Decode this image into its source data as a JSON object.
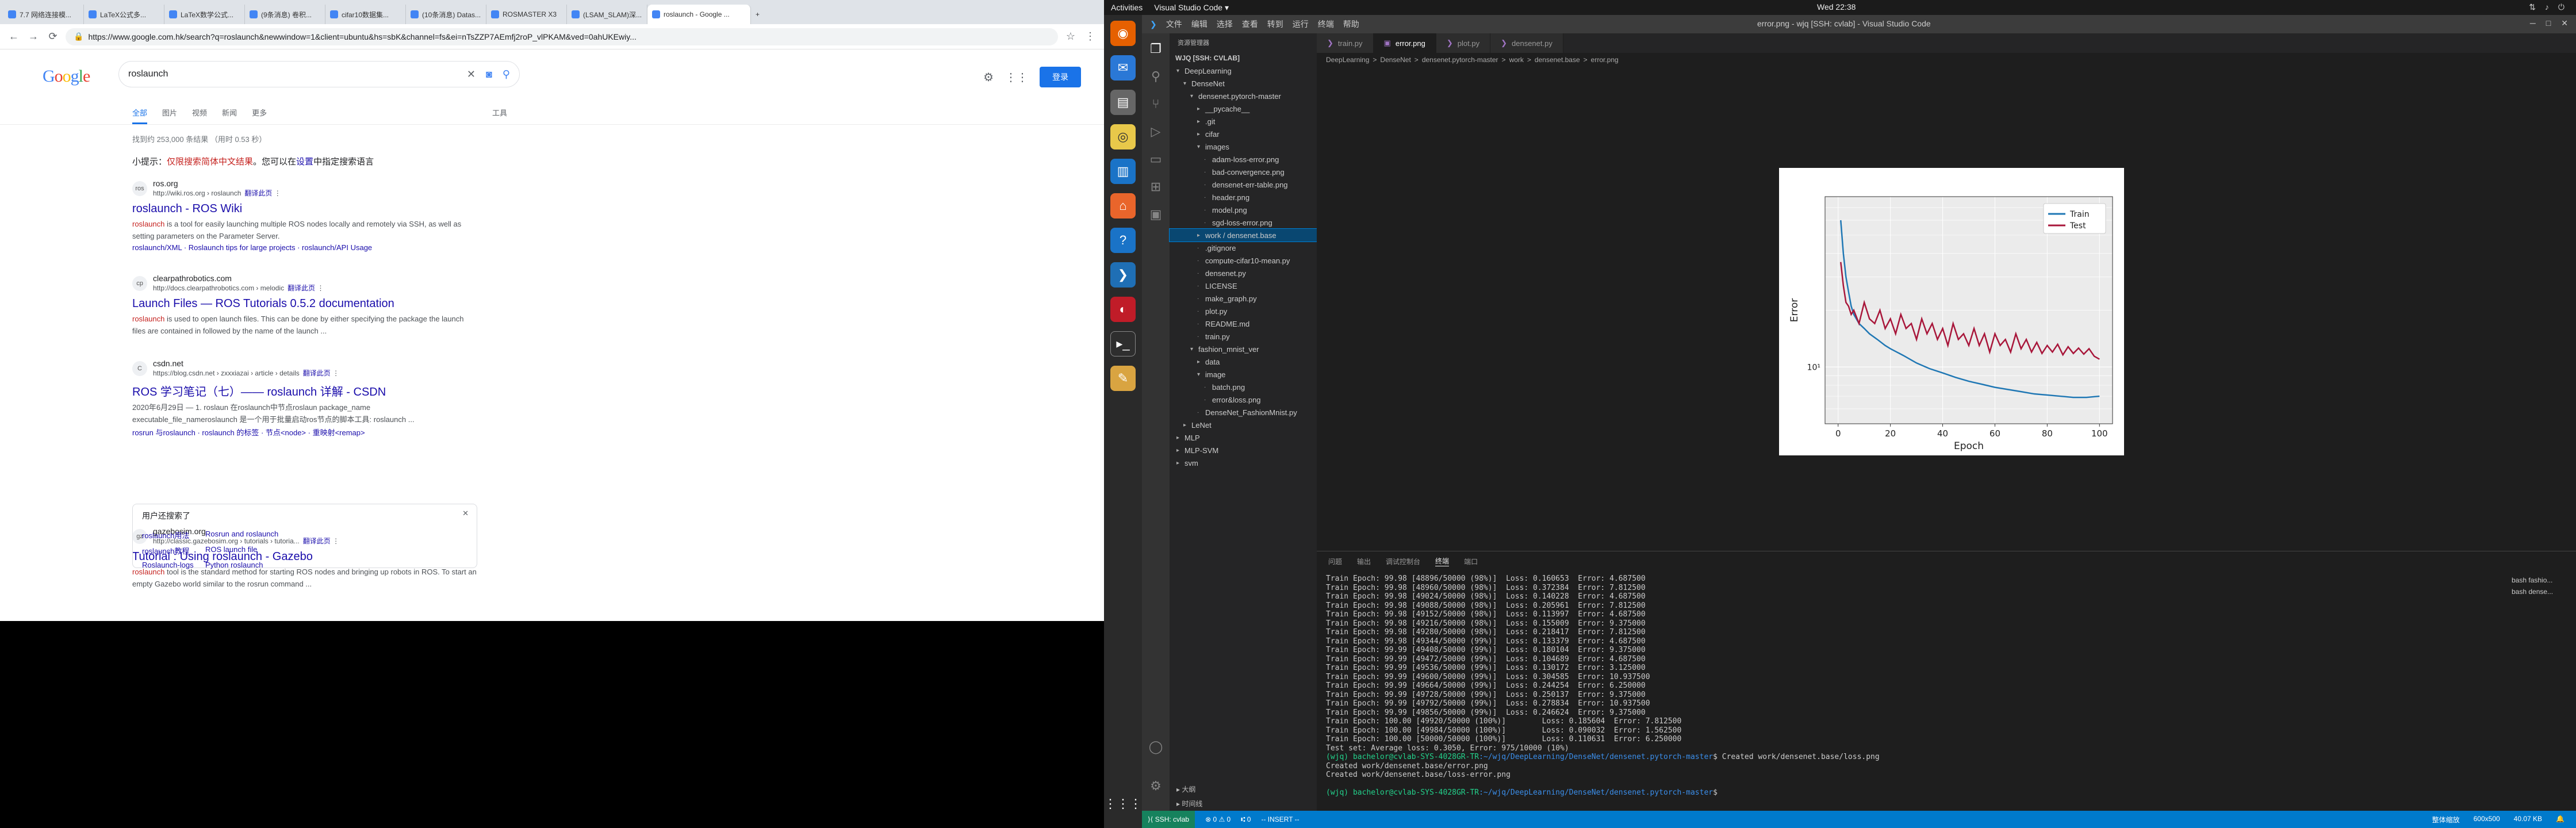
{
  "chrome": {
    "tabs": [
      "7.7 网络连接模...",
      "LaTeX公式多...",
      "LaTeX数学公式...",
      "(9条消息) 卷积...",
      "cifar10数据集...",
      "(10条消息) Datas...",
      "ROSMASTER X3",
      "(LSAM_SLAM)深...",
      "roslaunch - Google ..."
    ],
    "url": "https://www.google.com.hk/search?q=roslaunch&newwindow=1&client=ubuntu&hs=sbK&channel=fs&ei=nTsZZP7AEmfj2roP_vlPKAM&ved=0ahUKEwiy..."
  },
  "google": {
    "logo": "Google",
    "query": "roslaunch",
    "signin": "登录",
    "tabs": [
      "全部",
      "图片",
      "视频",
      "新闻",
      "更多"
    ],
    "tools": "工具",
    "stats": "找到约 253,000 条结果 （用时 0.53 秒）",
    "tip_prefix": "小提示：",
    "tip_red": "仅限搜索简体中文结果",
    "tip_mid": "。您可以在",
    "tip_link": "设置",
    "tip_suffix": "中指定搜索语言",
    "translate": "翻译此页",
    "results": [
      {
        "fav": "ros",
        "name": "ros.org",
        "url": "http://wiki.ros.org › roslaunch",
        "title": "roslaunch - ROS Wiki",
        "snip_em": "roslaunch",
        "snip": " is a tool for easily launching multiple ROS nodes locally and remotely via SSH, as well as setting parameters on the Parameter Server.",
        "links": "roslaunch/XML · Roslaunch tips for large projects · roslaunch/API Usage"
      },
      {
        "fav": "cp",
        "name": "clearpathrobotics.com",
        "url": "http://docs.clearpathrobotics.com › melodic",
        "title": "Launch Files — ROS Tutorials 0.5.2 documentation",
        "snip_em": "roslaunch",
        "snip": " is used to open launch files. This can be done by either specifying the package the launch files are contained in followed by the name of the launch ...",
        "links": ""
      },
      {
        "fav": "C",
        "name": "csdn.net",
        "url": "https://blog.csdn.net › zxxxiazai › article › details",
        "title": "ROS 学习笔记（七）—— roslaunch 详解 - CSDN",
        "snip_em": "",
        "snip": "2020年6月29日 — 1. roslaun 在roslaunch中节点roslaun package_name executable_file_nameroslaunch 是一个用于批量启动ros节点的脚本工具: roslaunch ...",
        "links": "rosrun 与roslaunch · roslaunch 的标签 · 节点<node> · 重映射<remap>"
      },
      {
        "fav": "gz",
        "name": "gazebosim.org",
        "url": "http://classic.gazebosim.org › tutorials › tutoria...",
        "title": "Tutorial : Using roslaunch - Gazebo",
        "snip_em": "roslaunch",
        "snip": " tool is the standard method for starting ROS nodes and bringing up robots in ROS. To start an empty Gazebo world similar to the rosrun command ...",
        "links": ""
      }
    ],
    "ask": {
      "title": "用户还搜索了",
      "items": [
        "roslaunch用法",
        "Rosrun and roslaunch",
        "roslaunch教程",
        "ROS launch file",
        "Roslaunch-logs",
        "Python roslaunch"
      ]
    }
  },
  "desktop": {
    "activities": "Activities",
    "app": "Visual Studio Code ▾",
    "clock": "Wed 22:38"
  },
  "vscode": {
    "menu": [
      "文件",
      "编辑",
      "选择",
      "查看",
      "转到",
      "运行",
      "终端",
      "帮助"
    ],
    "title": "error.png - wjq [SSH: cvlab] - Visual Studio Code",
    "explorer": "资源管理器",
    "root": "WJQ [SSH: CVLAB]",
    "tree": [
      {
        "d": 1,
        "a": "v",
        "t": "DeepLearning"
      },
      {
        "d": 2,
        "a": "v",
        "t": "DenseNet"
      },
      {
        "d": 3,
        "a": "v",
        "t": "densenet.pytorch-master"
      },
      {
        "d": 4,
        "a": ">",
        "t": "__pycache__"
      },
      {
        "d": 4,
        "a": ">",
        "t": ".git"
      },
      {
        "d": 4,
        "a": ">",
        "t": "cifar"
      },
      {
        "d": 4,
        "a": "v",
        "t": "images"
      },
      {
        "d": 5,
        "a": "",
        "t": "adam-loss-error.png"
      },
      {
        "d": 5,
        "a": "",
        "t": "bad-convergence.png"
      },
      {
        "d": 5,
        "a": "",
        "t": "densenet-err-table.png"
      },
      {
        "d": 5,
        "a": "",
        "t": "header.png"
      },
      {
        "d": 5,
        "a": "",
        "t": "model.png"
      },
      {
        "d": 5,
        "a": "",
        "t": "sgd-loss-error.png"
      },
      {
        "d": 4,
        "a": ">",
        "t": "work / densenet.base",
        "sel": true
      },
      {
        "d": 4,
        "a": "",
        "t": ".gitignore"
      },
      {
        "d": 4,
        "a": "",
        "t": "compute-cifar10-mean.py"
      },
      {
        "d": 4,
        "a": "",
        "t": "densenet.py"
      },
      {
        "d": 4,
        "a": "",
        "t": "LICENSE"
      },
      {
        "d": 4,
        "a": "",
        "t": "make_graph.py"
      },
      {
        "d": 4,
        "a": "",
        "t": "plot.py"
      },
      {
        "d": 4,
        "a": "",
        "t": "README.md"
      },
      {
        "d": 4,
        "a": "",
        "t": "train.py"
      },
      {
        "d": 3,
        "a": "v",
        "t": "fashion_mnist_ver"
      },
      {
        "d": 4,
        "a": ">",
        "t": "data"
      },
      {
        "d": 4,
        "a": "v",
        "t": "image"
      },
      {
        "d": 5,
        "a": "",
        "t": "batch.png"
      },
      {
        "d": 5,
        "a": "",
        "t": "error&loss.png"
      },
      {
        "d": 4,
        "a": "",
        "t": "DenseNet_FashionMnist.py"
      },
      {
        "d": 2,
        "a": ">",
        "t": "LeNet"
      },
      {
        "d": 1,
        "a": ">",
        "t": "MLP"
      },
      {
        "d": 1,
        "a": ">",
        "t": "MLP-SVM"
      },
      {
        "d": 1,
        "a": ">",
        "t": "svm"
      }
    ],
    "side_bottom": [
      "大纲",
      "时间线"
    ],
    "tabs": [
      {
        "t": "train.py",
        "on": false
      },
      {
        "t": "error.png",
        "on": true
      },
      {
        "t": "plot.py",
        "on": false
      },
      {
        "t": "densenet.py",
        "on": false
      }
    ],
    "crumbs": [
      "DeepLearning",
      ">",
      "DenseNet",
      ">",
      "densenet.pytorch-master",
      ">",
      "work",
      ">",
      "densenet.base",
      ">",
      "error.png"
    ],
    "panel_tabs": [
      "问题",
      "输出",
      "调试控制台",
      "终端",
      "端口"
    ],
    "terminal": [
      "Train Epoch: 99.98 [48896/50000 (98%)]  Loss: 0.160653  Error: 4.687500",
      "Train Epoch: 99.98 [48960/50000 (98%)]  Loss: 0.372384  Error: 7.812500",
      "Train Epoch: 99.98 [49024/50000 (98%)]  Loss: 0.140228  Error: 4.687500",
      "Train Epoch: 99.98 [49088/50000 (98%)]  Loss: 0.205961  Error: 7.812500",
      "Train Epoch: 99.98 [49152/50000 (98%)]  Loss: 0.113997  Error: 4.687500",
      "Train Epoch: 99.98 [49216/50000 (98%)]  Loss: 0.155009  Error: 9.375000",
      "Train Epoch: 99.98 [49280/50000 (98%)]  Loss: 0.218417  Error: 7.812500",
      "Train Epoch: 99.98 [49344/50000 (99%)]  Loss: 0.133379  Error: 4.687500",
      "Train Epoch: 99.99 [49408/50000 (99%)]  Loss: 0.180104  Error: 9.375000",
      "Train Epoch: 99.99 [49472/50000 (99%)]  Loss: 0.104689  Error: 4.687500",
      "Train Epoch: 99.99 [49536/50000 (99%)]  Loss: 0.130172  Error: 3.125000",
      "Train Epoch: 99.99 [49600/50000 (99%)]  Loss: 0.304585  Error: 10.937500",
      "Train Epoch: 99.99 [49664/50000 (99%)]  Loss: 0.244254  Error: 6.250000",
      "Train Epoch: 99.99 [49728/50000 (99%)]  Loss: 0.250137  Error: 9.375000",
      "Train Epoch: 99.99 [49792/50000 (99%)]  Loss: 0.278834  Error: 10.937500",
      "Train Epoch: 99.99 [49856/50000 (99%)]  Loss: 0.246624  Error: 9.375000",
      "Train Epoch: 100.00 [49920/50000 (100%)]        Loss: 0.185604  Error: 7.812500",
      "Train Epoch: 100.00 [49984/50000 (100%)]        Loss: 0.090032  Error: 1.562500",
      "Train Epoch: 100.00 [50000/50000 (100%)]        Loss: 0.110631  Error: 6.250000",
      "",
      "Test set: Average loss: 0.3050, Error: 975/10000 (10%)",
      ""
    ],
    "prompt_user": "(wjq) bachelor@cvlab-SYS-4028GR-TR",
    "prompt_path": ":~/wjq/DeepLearning/DenseNet/densenet.pytorch-master",
    "cmd1": "$ Created work/densenet.base/loss.png",
    "out1": "Created work/densenet.base/error.png",
    "out2": "Created work/densenet.base/loss-error.png",
    "cmd2": "$ ",
    "term_list": [
      "bash fashio...",
      "bash dense..."
    ],
    "status": {
      "remote": "⟩⟨ SSH: cvlab",
      "errors": "⊗ 0 ⚠ 0",
      "ports": "⑆ 0",
      "mode": "-- INSERT --",
      "dims": "600x500",
      "size": "40.07 KB",
      "zoom": "整体缩放"
    }
  },
  "chart_data": {
    "type": "line",
    "xlabel": "Epoch",
    "ylabel": "Error",
    "yscale": "log",
    "xlim": [
      -5,
      105
    ],
    "xticks": [
      0,
      20,
      40,
      60,
      80,
      100
    ],
    "ytick_label": "10¹",
    "ytick_value": 10,
    "grid": true,
    "legend": "top-right",
    "colors": {
      "Train": "#1f77b4",
      "Test": "#a8163a"
    },
    "series": [
      {
        "name": "Train",
        "x": [
          1,
          2,
          3,
          4,
          5,
          6,
          8,
          10,
          12,
          15,
          18,
          20,
          25,
          30,
          35,
          40,
          45,
          50,
          55,
          60,
          65,
          70,
          75,
          80,
          85,
          90,
          95,
          100
        ],
        "values": [
          60,
          40,
          30,
          25,
          21,
          19,
          17,
          16,
          15,
          14,
          13,
          12.5,
          11.5,
          10.5,
          9.8,
          9.3,
          8.8,
          8.4,
          8.1,
          7.8,
          7.6,
          7.4,
          7.2,
          7.1,
          7.0,
          6.9,
          6.9,
          7.0
        ]
      },
      {
        "name": "Test",
        "x": [
          1,
          2,
          3,
          4,
          5,
          6,
          8,
          10,
          12,
          14,
          16,
          18,
          20,
          22,
          24,
          26,
          28,
          30,
          32,
          34,
          36,
          38,
          40,
          42,
          44,
          46,
          48,
          50,
          52,
          54,
          56,
          58,
          60,
          62,
          64,
          66,
          68,
          70,
          72,
          74,
          76,
          78,
          80,
          82,
          84,
          86,
          88,
          90,
          92,
          94,
          96,
          98,
          100
        ],
        "values": [
          36,
          27,
          22,
          21,
          19,
          20,
          17,
          22,
          18,
          17,
          20,
          16,
          18,
          15,
          19,
          16,
          17,
          14,
          18,
          15,
          17,
          14,
          16,
          13,
          17,
          14,
          15,
          13,
          16,
          13,
          15,
          12,
          15,
          13,
          14,
          12,
          15,
          12.5,
          14,
          12,
          13.5,
          11.8,
          13,
          12,
          13.2,
          11.6,
          12.8,
          11.8,
          12.6,
          11.7,
          12.5,
          11.4,
          11
        ]
      }
    ]
  }
}
